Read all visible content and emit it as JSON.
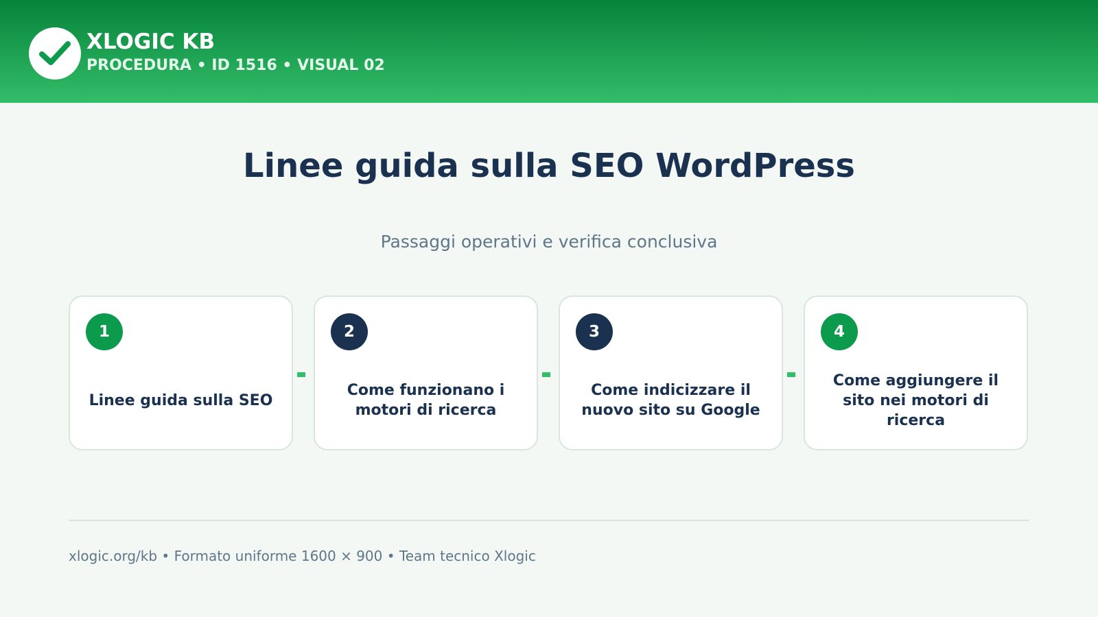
{
  "header": {
    "brand_name": "XLOGIC KB",
    "meta_line": "PROCEDURA • ID 1516 • VISUAL 02",
    "logo_icon": "checkmark-icon",
    "colors": {
      "gradient_top": "#06833a",
      "gradient_bottom": "#33bd69"
    }
  },
  "main": {
    "title": "Linee guida sulla SEO WordPress",
    "subtitle": "Passaggi operativi e verifica conclusiva"
  },
  "steps": [
    {
      "number": "1",
      "label": "Linee guida sulla SEO",
      "badge_color": "#0c9a4c"
    },
    {
      "number": "2",
      "label": "Come funzionano i motori di ricerca",
      "badge_color": "#1a3150"
    },
    {
      "number": "3",
      "label": "Come indicizzare il nuovo sito su Google",
      "badge_color": "#1a3150"
    },
    {
      "number": "4",
      "label": "Come aggiungere il sito nei motori di ricerca",
      "badge_color": "#0c9a4c"
    }
  ],
  "footer": {
    "text": "xlogic.org/kb • Formato uniforme 1600 × 900 • Team tecnico Xlogic"
  },
  "colors": {
    "accent_green": "#33bd69",
    "navy": "#1a3150",
    "muted_text": "#5f7689",
    "background": "#f4f8f5"
  }
}
